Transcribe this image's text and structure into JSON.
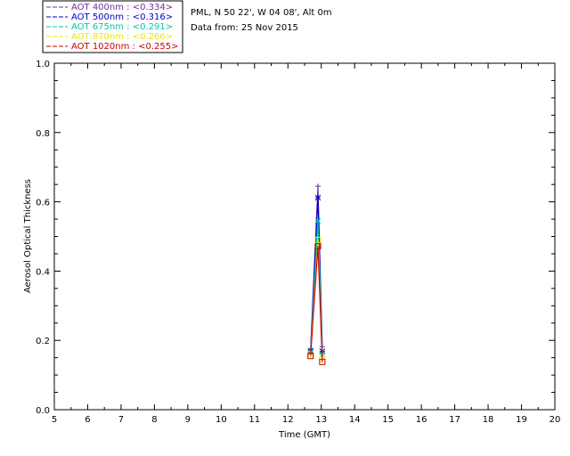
{
  "info": {
    "location": "PML, N 50 22', W 04 08', Alt 0m",
    "date_line": "Data from: 25 Nov 2015"
  },
  "chart_data": {
    "type": "line",
    "xlabel": "Time (GMT)",
    "ylabel": "Aerosol Optical Thickness",
    "xlim": [
      5,
      20
    ],
    "ylim": [
      0.0,
      1.0
    ],
    "xticks": [
      "5",
      "6",
      "7",
      "8",
      "9",
      "10",
      "11",
      "12",
      "13",
      "14",
      "15",
      "16",
      "17",
      "18",
      "19",
      "20"
    ],
    "yticks": [
      "0.0",
      "0.2",
      "0.4",
      "0.6",
      "0.8",
      "1.0"
    ],
    "grid": false,
    "legend_position": "top-left",
    "series": [
      {
        "name": "AOT  400nm : <0.334>",
        "color": "#7030a0",
        "x": [
          12.68,
          12.9,
          13.03
        ],
        "y": [
          0.175,
          0.645,
          0.182
        ]
      },
      {
        "name": "AOT  500nm : <0.316>",
        "color": "#0000cc",
        "x": [
          12.68,
          12.9,
          13.03
        ],
        "y": [
          0.17,
          0.612,
          0.168
        ]
      },
      {
        "name": "AOT  675nm : <0.291>",
        "color": "#00c8a0",
        "x": [
          12.68,
          12.9,
          13.03
        ],
        "y": [
          0.165,
          0.545,
          0.16
        ]
      },
      {
        "name": "AOT  870nm : <0.266>",
        "color": "#e8e800",
        "x": [
          12.68,
          12.9,
          13.03
        ],
        "y": [
          0.16,
          0.49,
          0.146
        ]
      },
      {
        "name": "AOT 1020nm : <0.255>",
        "color": "#cc0000",
        "x": [
          12.68,
          12.9,
          13.03
        ],
        "y": [
          0.155,
          0.472,
          0.138
        ]
      }
    ]
  }
}
